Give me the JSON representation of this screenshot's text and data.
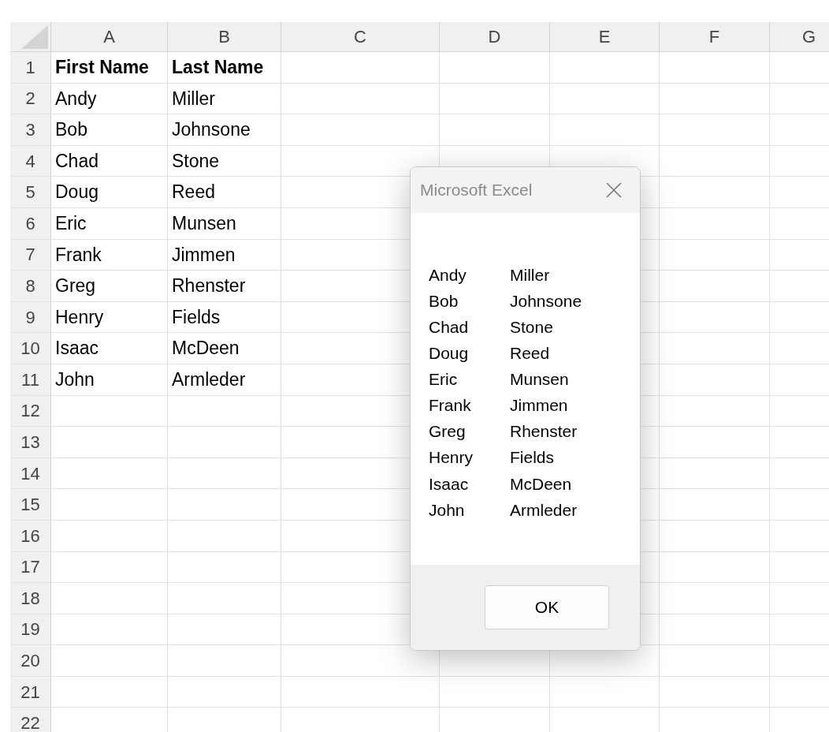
{
  "sheet": {
    "columns": [
      "A",
      "B",
      "C",
      "D",
      "E",
      "F",
      "G"
    ],
    "header_row": {
      "label": "1",
      "cells": [
        "First Name",
        "Last Name"
      ]
    },
    "rows": [
      {
        "label": "2",
        "cells": [
          "Andy",
          "Miller"
        ]
      },
      {
        "label": "3",
        "cells": [
          "Bob",
          "Johnsone"
        ]
      },
      {
        "label": "4",
        "cells": [
          "Chad",
          "Stone"
        ]
      },
      {
        "label": "5",
        "cells": [
          "Doug",
          "Reed"
        ]
      },
      {
        "label": "6",
        "cells": [
          "Eric",
          "Munsen"
        ]
      },
      {
        "label": "7",
        "cells": [
          "Frank",
          "Jimmen"
        ]
      },
      {
        "label": "8",
        "cells": [
          "Greg",
          "Rhenster"
        ]
      },
      {
        "label": "9",
        "cells": [
          "Henry",
          "Fields"
        ]
      },
      {
        "label": "10",
        "cells": [
          "Isaac",
          "McDeen"
        ]
      },
      {
        "label": "11",
        "cells": [
          "John",
          "Armleder"
        ]
      },
      {
        "label": "12"
      },
      {
        "label": "13"
      },
      {
        "label": "14"
      },
      {
        "label": "15"
      },
      {
        "label": "16"
      },
      {
        "label": "17"
      },
      {
        "label": "18"
      },
      {
        "label": "19"
      },
      {
        "label": "20"
      },
      {
        "label": "21"
      },
      {
        "label": "22"
      }
    ]
  },
  "dialog": {
    "title": "Microsoft Excel",
    "lines": [
      [
        "Andy",
        "Miller"
      ],
      [
        "Bob",
        "Johnsone"
      ],
      [
        "Chad",
        "Stone"
      ],
      [
        "Doug",
        "Reed"
      ],
      [
        "Eric",
        "Munsen"
      ],
      [
        "Frank",
        "Jimmen"
      ],
      [
        "Greg",
        "Rhenster"
      ],
      [
        "Henry",
        "Fields"
      ],
      [
        "Isaac",
        "McDeen"
      ],
      [
        "John",
        "Armleder"
      ]
    ],
    "button": "OK"
  }
}
